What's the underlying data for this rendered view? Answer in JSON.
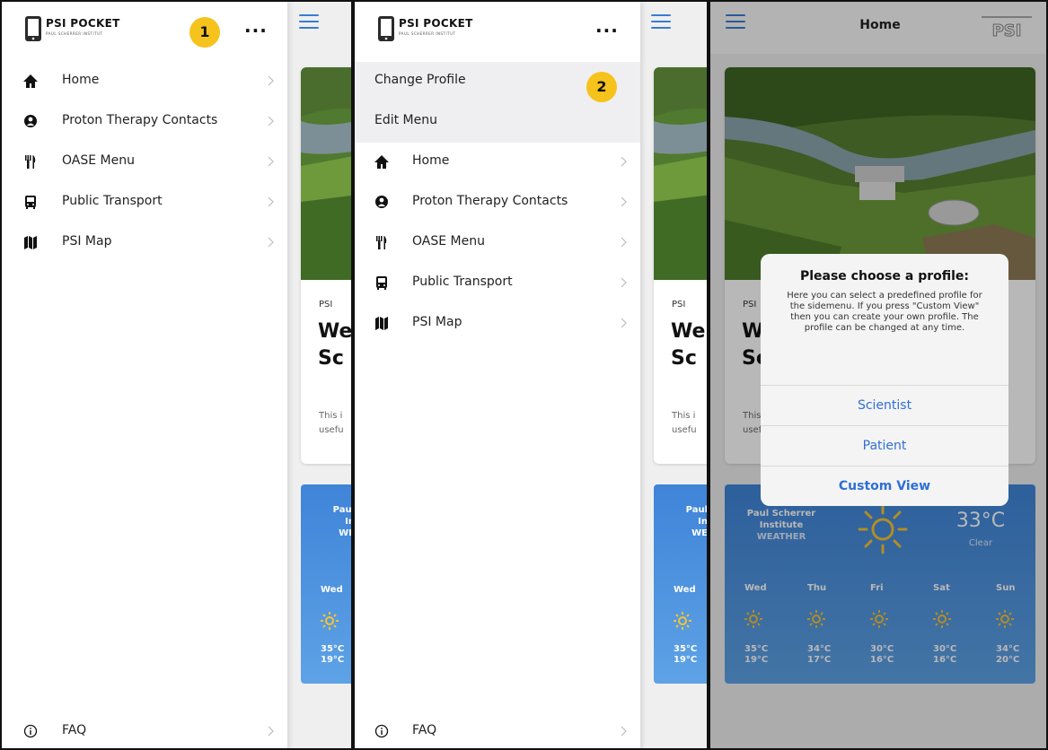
{
  "app": {
    "brand_title": "PSI POCKET",
    "brand_subtitle": "PAUL SCHERRER INSTITUT",
    "more_glyph": "...",
    "menu": [
      {
        "label": "Home",
        "icon": "home-icon"
      },
      {
        "label": "Proton Therapy Contacts",
        "icon": "contact-icon"
      },
      {
        "label": "OASE Menu",
        "icon": "cutlery-icon"
      },
      {
        "label": "Public Transport",
        "icon": "bus-icon"
      },
      {
        "label": "PSI Map",
        "icon": "map-icon"
      }
    ],
    "faq_label": "FAQ",
    "profile_menu": {
      "change_profile": "Change Profile",
      "edit_menu": "Edit Menu"
    },
    "steps": [
      "1",
      "2"
    ],
    "accent_color": "#3a7bd5",
    "badge_color": "#f6c21c"
  },
  "home": {
    "title": "Home",
    "psi_logo_text": "PSI",
    "card": {
      "tag": "PSI",
      "title_visible": "We\nSc",
      "text_visible": "This i\nusefu"
    },
    "weather": {
      "city_visible": "Paul\nIn\nWE",
      "city_full": "Paul Scherrer\nInstitute",
      "label": "WEATHER",
      "temperature": "33°C",
      "condition": "Clear",
      "days": [
        {
          "day": "Wed",
          "high": "35°C",
          "low": "19°C"
        },
        {
          "day": "Thu",
          "high": "34°C",
          "low": "17°C"
        },
        {
          "day": "Fri",
          "high": "30°C",
          "low": "16°C"
        },
        {
          "day": "Sat",
          "high": "30°C",
          "low": "16°C"
        },
        {
          "day": "Sun",
          "high": "34°C",
          "low": "20°C"
        }
      ]
    },
    "dialog": {
      "title": "Please choose a profile:",
      "message": "Here you can select a predefined profile for the sidemenu. If you press \"Custom View\" then you can create your own profile. The profile can be changed at any time.",
      "options": [
        "Scientist",
        "Patient",
        "Custom View"
      ]
    }
  }
}
